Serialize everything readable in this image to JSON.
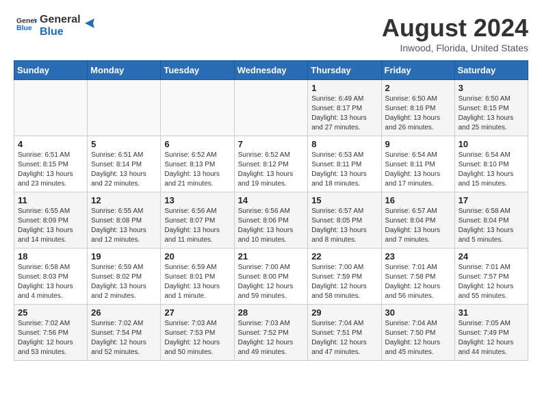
{
  "header": {
    "logo_line1": "General",
    "logo_line2": "Blue",
    "month_title": "August 2024",
    "location": "Inwood, Florida, United States"
  },
  "weekdays": [
    "Sunday",
    "Monday",
    "Tuesday",
    "Wednesday",
    "Thursday",
    "Friday",
    "Saturday"
  ],
  "weeks": [
    [
      {
        "day": "",
        "info": ""
      },
      {
        "day": "",
        "info": ""
      },
      {
        "day": "",
        "info": ""
      },
      {
        "day": "",
        "info": ""
      },
      {
        "day": "1",
        "info": "Sunrise: 6:49 AM\nSunset: 8:17 PM\nDaylight: 13 hours and 27 minutes."
      },
      {
        "day": "2",
        "info": "Sunrise: 6:50 AM\nSunset: 8:16 PM\nDaylight: 13 hours and 26 minutes."
      },
      {
        "day": "3",
        "info": "Sunrise: 6:50 AM\nSunset: 8:15 PM\nDaylight: 13 hours and 25 minutes."
      }
    ],
    [
      {
        "day": "4",
        "info": "Sunrise: 6:51 AM\nSunset: 8:15 PM\nDaylight: 13 hours and 23 minutes."
      },
      {
        "day": "5",
        "info": "Sunrise: 6:51 AM\nSunset: 8:14 PM\nDaylight: 13 hours and 22 minutes."
      },
      {
        "day": "6",
        "info": "Sunrise: 6:52 AM\nSunset: 8:13 PM\nDaylight: 13 hours and 21 minutes."
      },
      {
        "day": "7",
        "info": "Sunrise: 6:52 AM\nSunset: 8:12 PM\nDaylight: 13 hours and 19 minutes."
      },
      {
        "day": "8",
        "info": "Sunrise: 6:53 AM\nSunset: 8:11 PM\nDaylight: 13 hours and 18 minutes."
      },
      {
        "day": "9",
        "info": "Sunrise: 6:54 AM\nSunset: 8:11 PM\nDaylight: 13 hours and 17 minutes."
      },
      {
        "day": "10",
        "info": "Sunrise: 6:54 AM\nSunset: 8:10 PM\nDaylight: 13 hours and 15 minutes."
      }
    ],
    [
      {
        "day": "11",
        "info": "Sunrise: 6:55 AM\nSunset: 8:09 PM\nDaylight: 13 hours and 14 minutes."
      },
      {
        "day": "12",
        "info": "Sunrise: 6:55 AM\nSunset: 8:08 PM\nDaylight: 13 hours and 12 minutes."
      },
      {
        "day": "13",
        "info": "Sunrise: 6:56 AM\nSunset: 8:07 PM\nDaylight: 13 hours and 11 minutes."
      },
      {
        "day": "14",
        "info": "Sunrise: 6:56 AM\nSunset: 8:06 PM\nDaylight: 13 hours and 10 minutes."
      },
      {
        "day": "15",
        "info": "Sunrise: 6:57 AM\nSunset: 8:05 PM\nDaylight: 13 hours and 8 minutes."
      },
      {
        "day": "16",
        "info": "Sunrise: 6:57 AM\nSunset: 8:04 PM\nDaylight: 13 hours and 7 minutes."
      },
      {
        "day": "17",
        "info": "Sunrise: 6:58 AM\nSunset: 8:04 PM\nDaylight: 13 hours and 5 minutes."
      }
    ],
    [
      {
        "day": "18",
        "info": "Sunrise: 6:58 AM\nSunset: 8:03 PM\nDaylight: 13 hours and 4 minutes."
      },
      {
        "day": "19",
        "info": "Sunrise: 6:59 AM\nSunset: 8:02 PM\nDaylight: 13 hours and 2 minutes."
      },
      {
        "day": "20",
        "info": "Sunrise: 6:59 AM\nSunset: 8:01 PM\nDaylight: 13 hours and 1 minute."
      },
      {
        "day": "21",
        "info": "Sunrise: 7:00 AM\nSunset: 8:00 PM\nDaylight: 12 hours and 59 minutes."
      },
      {
        "day": "22",
        "info": "Sunrise: 7:00 AM\nSunset: 7:59 PM\nDaylight: 12 hours and 58 minutes."
      },
      {
        "day": "23",
        "info": "Sunrise: 7:01 AM\nSunset: 7:58 PM\nDaylight: 12 hours and 56 minutes."
      },
      {
        "day": "24",
        "info": "Sunrise: 7:01 AM\nSunset: 7:57 PM\nDaylight: 12 hours and 55 minutes."
      }
    ],
    [
      {
        "day": "25",
        "info": "Sunrise: 7:02 AM\nSunset: 7:56 PM\nDaylight: 12 hours and 53 minutes."
      },
      {
        "day": "26",
        "info": "Sunrise: 7:02 AM\nSunset: 7:54 PM\nDaylight: 12 hours and 52 minutes."
      },
      {
        "day": "27",
        "info": "Sunrise: 7:03 AM\nSunset: 7:53 PM\nDaylight: 12 hours and 50 minutes."
      },
      {
        "day": "28",
        "info": "Sunrise: 7:03 AM\nSunset: 7:52 PM\nDaylight: 12 hours and 49 minutes."
      },
      {
        "day": "29",
        "info": "Sunrise: 7:04 AM\nSunset: 7:51 PM\nDaylight: 12 hours and 47 minutes."
      },
      {
        "day": "30",
        "info": "Sunrise: 7:04 AM\nSunset: 7:50 PM\nDaylight: 12 hours and 45 minutes."
      },
      {
        "day": "31",
        "info": "Sunrise: 7:05 AM\nSunset: 7:49 PM\nDaylight: 12 hours and 44 minutes."
      }
    ]
  ]
}
